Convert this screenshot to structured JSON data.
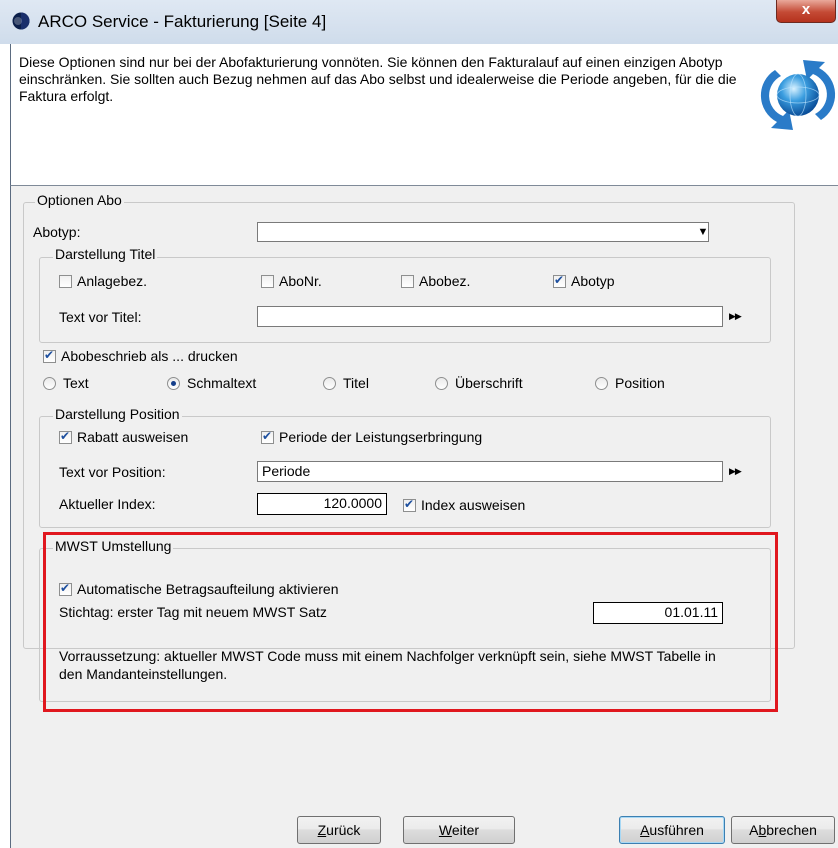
{
  "window": {
    "title": "ARCO Service - Fakturierung [Seite 4]",
    "close_label": "x"
  },
  "header": {
    "description": "Diese Optionen sind nur bei der Abofakturierung vonnöten. Sie können den Fakturalauf auf einen einzigen Abotyp einschränken. Sie sollten auch Bezug nehmen auf das Abo selbst und idealerweise die Periode angeben, für die die Faktura erfolgt."
  },
  "optionen_abo": {
    "legend": "Optionen Abo",
    "abotyp_label": "Abotyp:",
    "abotyp_value": "",
    "darstellung_titel": {
      "legend": "Darstellung Titel",
      "checkboxes": [
        {
          "label": "Anlagebez.",
          "checked": false
        },
        {
          "label": "AboNr.",
          "checked": false
        },
        {
          "label": "Abobez.",
          "checked": false
        },
        {
          "label": "Abotyp",
          "checked": true
        }
      ],
      "text_label": "Text vor Titel:",
      "text_value": ""
    },
    "abobeschrieb": {
      "label": "Abobeschrieb als ... drucken",
      "checked": true
    },
    "radios": [
      {
        "label": "Text",
        "checked": false
      },
      {
        "label": "Schmaltext",
        "checked": true
      },
      {
        "label": "Titel",
        "checked": false
      },
      {
        "label": "Überschrift",
        "checked": false
      },
      {
        "label": "Position",
        "checked": false
      }
    ],
    "darstellung_position": {
      "legend": "Darstellung Position",
      "rabatt": {
        "label": "Rabatt ausweisen",
        "checked": true
      },
      "periode": {
        "label": "Periode der Leistungserbringung",
        "checked": true
      },
      "text_label": "Text vor Position:",
      "text_value": "Periode",
      "index_label": "Aktueller Index:",
      "index_value": "120.0000",
      "index_ausweisen": {
        "label": "Index ausweisen",
        "checked": true
      }
    },
    "mwst": {
      "legend": "MWST Umstellung",
      "auto": {
        "label": "Automatische Betragsaufteilung aktivieren",
        "checked": true
      },
      "stichtag_label": "Stichtag: erster Tag mit neuem MWST Satz",
      "stichtag_value": "01.01.11",
      "note": "Vorraussetzung: aktueller MWST Code muss mit einem Nachfolger verknüpft sein, siehe MWST Tabelle in den Mandanteinstellungen."
    }
  },
  "buttons": {
    "back_pre": "",
    "back_u": "Z",
    "back_post": "urück",
    "next_pre": "",
    "next_u": "W",
    "next_post": "eiter",
    "run_pre": "",
    "run_u": "A",
    "run_post": "usführen",
    "cancel_pre": "A",
    "cancel_u": "b",
    "cancel_post": "brechen"
  },
  "colors": {
    "highlight": "#e0171e",
    "accent": "#153f8b"
  }
}
